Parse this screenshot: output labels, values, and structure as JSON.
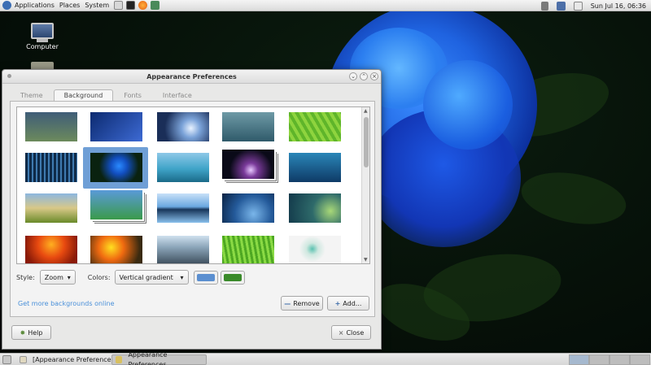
{
  "top_panel": {
    "menus": [
      "Applications",
      "Places",
      "System"
    ],
    "clock": "Sun Jul 16, 06:36"
  },
  "desktop": {
    "icons": [
      {
        "label": "Computer",
        "icon": "computer-icon"
      },
      {
        "label": "",
        "icon": "folder-icon"
      }
    ]
  },
  "dialog": {
    "title": "Appearance Preferences",
    "tabs": [
      "Theme",
      "Background",
      "Fonts",
      "Interface"
    ],
    "active_tab": "Background",
    "style_label": "Style:",
    "style_value": "Zoom",
    "colors_label": "Colors:",
    "colors_value": "Vertical gradient",
    "primary_color": "#5b8fd0",
    "secondary_color": "#3a8a2a",
    "link_text": "Get more backgrounds online",
    "remove_label": "Remove",
    "add_label": "Add...",
    "help_label": "Help",
    "close_label": "Close"
  },
  "bottom_panel": {
    "tasks": [
      "[Appearance Preferences]",
      "Appearance Preferences"
    ]
  }
}
